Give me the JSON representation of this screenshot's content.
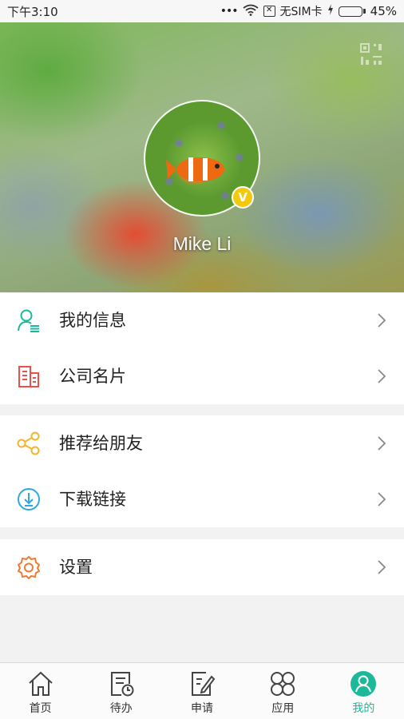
{
  "status_bar": {
    "time": "下午3:10",
    "dots": "•••",
    "sim_text": "无SIM卡",
    "battery_percent": "45%",
    "battery_level": 0.45
  },
  "profile": {
    "name": "Mike Li",
    "badge": "V"
  },
  "menu": {
    "groups": [
      [
        {
          "label": "我的信息",
          "icon": "user-info-icon"
        },
        {
          "label": "公司名片",
          "icon": "building-icon"
        }
      ],
      [
        {
          "label": "推荐给朋友",
          "icon": "share-icon"
        },
        {
          "label": "下载链接",
          "icon": "download-icon"
        }
      ],
      [
        {
          "label": "设置",
          "icon": "gear-icon"
        }
      ]
    ]
  },
  "tabbar": {
    "items": [
      {
        "label": "首页",
        "icon": "home-icon"
      },
      {
        "label": "待办",
        "icon": "todo-icon"
      },
      {
        "label": "申请",
        "icon": "apply-icon"
      },
      {
        "label": "应用",
        "icon": "apps-icon"
      },
      {
        "label": "我的",
        "icon": "profile-icon",
        "active": true
      }
    ]
  },
  "colors": {
    "accent": "#1bb99a",
    "badge": "#f2c90e",
    "user_info_icon": "#1bb99a",
    "building_icon": "#e9524a",
    "share_icon": "#f3b52b",
    "download_icon": "#2fa8e0",
    "gear_icon": "#ef7a33"
  }
}
